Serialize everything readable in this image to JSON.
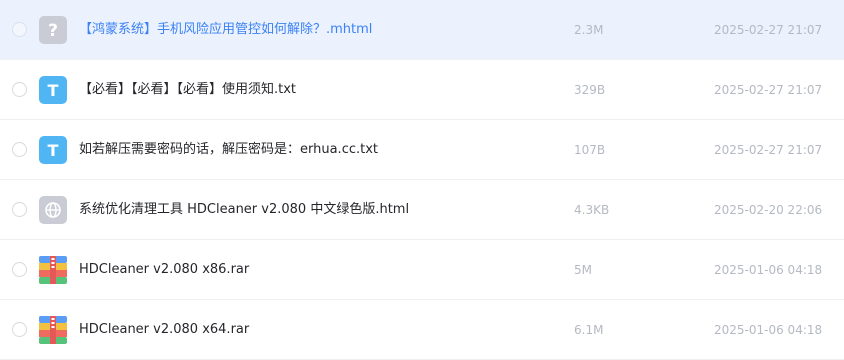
{
  "files": [
    {
      "name": "【鸿蒙系统】手机风险应用管控如何解除？.mhtml",
      "size": "2.3M",
      "date": "2025-02-27 21:07",
      "icon": "unknown-file-icon",
      "selected": true
    },
    {
      "name": "【必看】【必看】【必看】使用须知.txt",
      "size": "329B",
      "date": "2025-02-27 21:07",
      "icon": "text-file-icon",
      "selected": false
    },
    {
      "name": "如若解压需要密码的话，解压密码是：erhua.cc.txt",
      "size": "107B",
      "date": "2025-02-27 21:07",
      "icon": "text-file-icon",
      "selected": false
    },
    {
      "name": "系统优化清理工具 HDCleaner v2.080 中文绿色版.html",
      "size": "4.3KB",
      "date": "2025-02-20 22:06",
      "icon": "web-file-icon",
      "selected": false
    },
    {
      "name": "HDCleaner v2.080 x86.rar",
      "size": "5M",
      "date": "2025-01-06 04:18",
      "icon": "archive-file-icon",
      "selected": false
    },
    {
      "name": "HDCleaner v2.080 x64.rar",
      "size": "6.1M",
      "date": "2025-01-06 04:18",
      "icon": "archive-file-icon",
      "selected": false
    }
  ],
  "colors": {
    "selected_row_bg": "#ebf1fd",
    "selected_text": "#3b82f6",
    "text_icon": "#4fb6f3",
    "unknown_icon": "#c9ccd4",
    "web_icon": "#c9ccd4"
  }
}
